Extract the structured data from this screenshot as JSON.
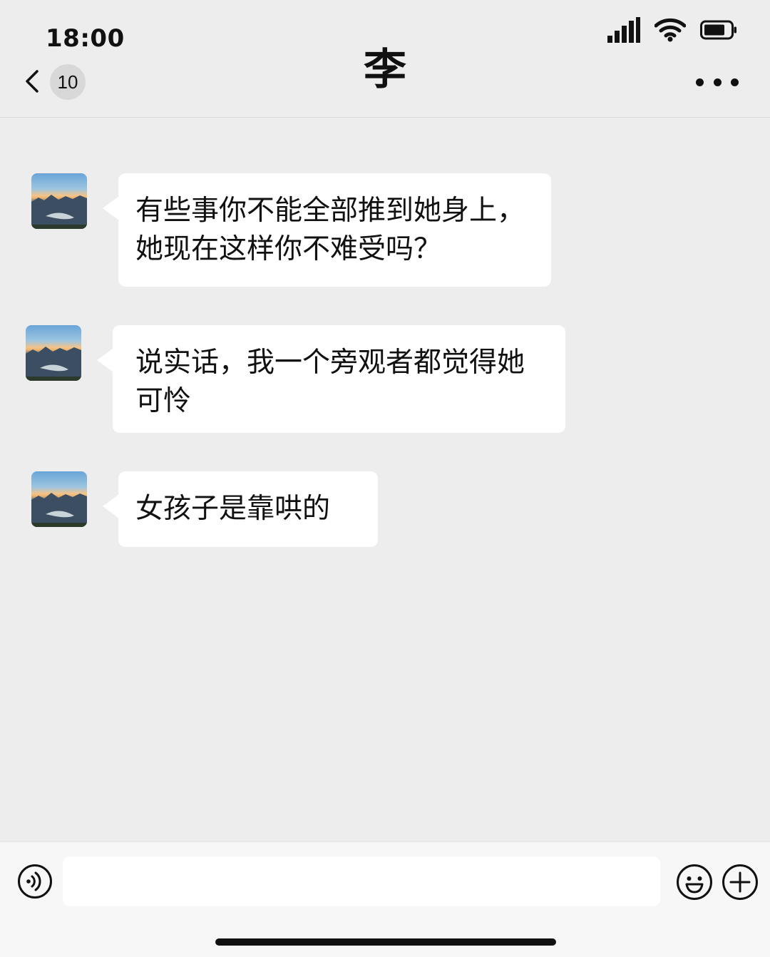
{
  "status_bar": {
    "time": "18:00"
  },
  "header": {
    "back_count": "10",
    "title": "李"
  },
  "messages": [
    {
      "text": "有些事你不能全部推到她身上，她现在这样你不难受吗？"
    },
    {
      "text": "说实话，我一个旁观者都觉得她可怜"
    },
    {
      "text": "女孩子是靠哄的"
    }
  ],
  "input": {
    "value": ""
  },
  "icons": {
    "back": "chevron-left-icon",
    "more": "more-dots-icon",
    "voice": "voice-icon",
    "emoji": "emoji-icon",
    "plus": "plus-icon",
    "signal": "cellular-signal-icon",
    "wifi": "wifi-icon",
    "battery": "battery-icon"
  },
  "colors": {
    "background": "#ededed",
    "bubble": "#ffffff",
    "input_bar": "#f7f7f7"
  }
}
